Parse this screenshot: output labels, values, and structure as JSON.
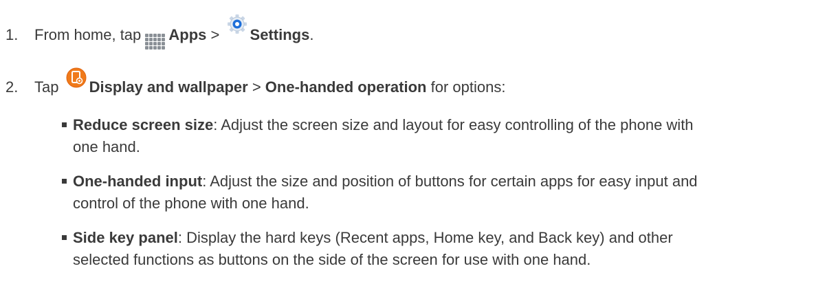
{
  "step1": {
    "number": "1.",
    "before_icon_text": "From home, tap",
    "apps_icon": "apps-grid-icon",
    "apps_label": "Apps",
    "separator": ">",
    "settings_icon": "settings-gear-icon",
    "settings_label": "Settings",
    "end": "."
  },
  "step2": {
    "number": "2.",
    "before_icon_text": "Tap",
    "display_icon": "display-wallpaper-icon",
    "display_label": "Display and wallpaper",
    "separator": ">",
    "option_label": "One-handed operation",
    "after_text": "for options:"
  },
  "bullets": [
    {
      "term": "Reduce screen size",
      "line1": ": Adjust the screen size and layout for easy controlling of the phone with",
      "line2": "one hand."
    },
    {
      "term": "One-handed input",
      "line1": ": Adjust the size and position of buttons for certain apps for easy input and",
      "line2": "control of the phone with one hand."
    },
    {
      "term": "Side key panel",
      "line1": ": Display the hard keys (Recent apps, Home key, and Back key) and other",
      "line2": "selected functions as buttons on the side of the screen for use with one hand."
    }
  ],
  "colors": {
    "text": "#3a3a3a",
    "apps_icon_gray": "#8a9096",
    "settings_blue": "#1e6fd9",
    "display_orange": "#f07a1a"
  }
}
